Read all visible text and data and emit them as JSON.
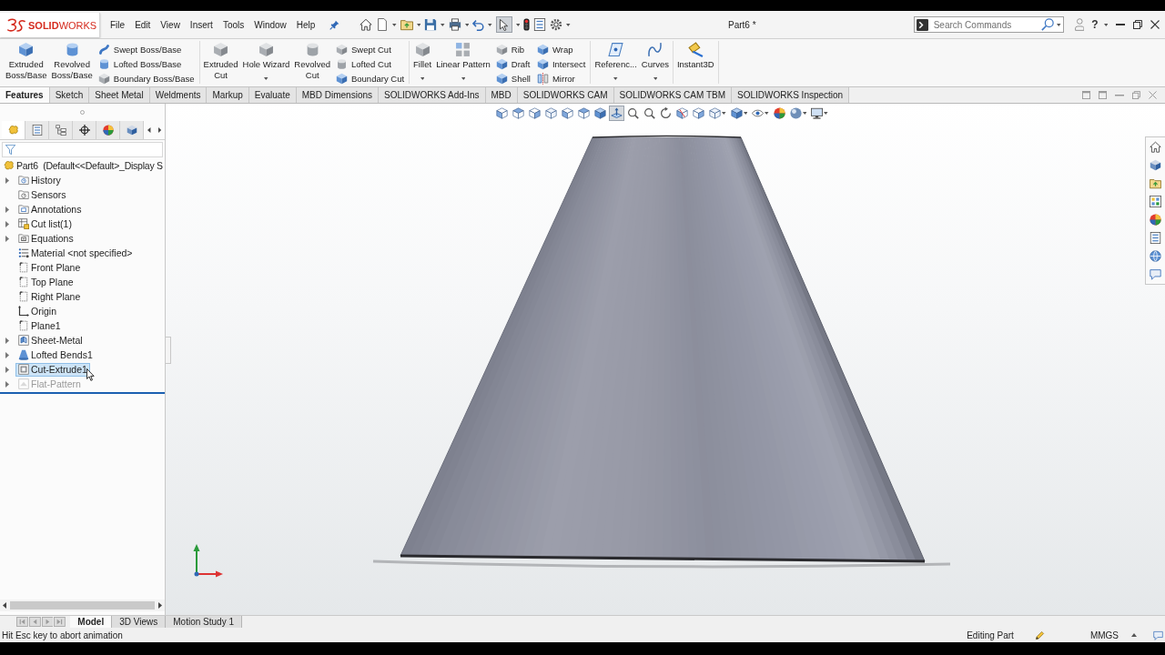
{
  "title_bar": {
    "logo": "**SOLID**WORKS",
    "menu": [
      "File",
      "Edit",
      "View",
      "Insert",
      "Tools",
      "Window",
      "Help"
    ],
    "select_tool_selected": true,
    "document_title": "Part6 *",
    "search": {
      "placeholder": "Search Commands"
    },
    "help": "?"
  },
  "ribbon": {
    "groups": [
      [
        {
          "kind": "large",
          "lines": [
            "Extruded",
            "Boss/Base"
          ],
          "dropdown": false
        },
        {
          "kind": "large",
          "lines": [
            "Revolved",
            "Boss/Base"
          ],
          "dropdown": false
        },
        {
          "kind": "stack",
          "buttons": [
            "Swept Boss/Base",
            "Lofted Boss/Base",
            "Boundary Boss/Base"
          ]
        }
      ],
      [
        {
          "kind": "large",
          "lines": [
            "Extruded",
            "Cut"
          ],
          "dropdown": false
        },
        {
          "kind": "large",
          "lines": [
            "Hole Wizard"
          ],
          "dropdown": true
        },
        {
          "kind": "large",
          "lines": [
            "Revolved",
            "Cut"
          ],
          "dropdown": false
        },
        {
          "kind": "stack",
          "buttons": [
            "Swept Cut",
            "Lofted Cut",
            "Boundary Cut"
          ]
        }
      ],
      [
        {
          "kind": "large",
          "lines": [
            "Fillet"
          ],
          "dropdown": true
        },
        {
          "kind": "large",
          "lines": [
            "Linear Pattern"
          ],
          "dropdown": true
        },
        {
          "kind": "stack",
          "buttons": [
            "Rib",
            "Draft",
            "Shell"
          ]
        },
        {
          "kind": "stack",
          "buttons": [
            "Wrap",
            "Intersect",
            "Mirror"
          ]
        }
      ],
      [
        {
          "kind": "large",
          "lines": [
            "Referenc..."
          ],
          "dropdown": true
        },
        {
          "kind": "large",
          "lines": [
            "Curves"
          ],
          "dropdown": true
        }
      ],
      [
        {
          "kind": "large",
          "lines": [
            "Instant3D"
          ],
          "dropdown": false
        }
      ]
    ]
  },
  "command_tabs": [
    {
      "label": "Features",
      "selected": true
    },
    {
      "label": "Sketch",
      "selected": false
    },
    {
      "label": "Sheet Metal",
      "selected": false
    },
    {
      "label": "Weldments",
      "selected": false
    },
    {
      "label": "Markup",
      "selected": false
    },
    {
      "label": "Evaluate",
      "selected": false
    },
    {
      "label": "MBD Dimensions",
      "selected": false
    },
    {
      "label": "SOLIDWORKS Add-Ins",
      "selected": false
    },
    {
      "label": "MBD",
      "selected": false
    },
    {
      "label": "SOLIDWORKS CAM",
      "selected": false
    },
    {
      "label": "SOLIDWORKS CAM TBM",
      "selected": false
    },
    {
      "label": "SOLIDWORKS Inspection",
      "selected": false
    }
  ],
  "feature_manager": {
    "tabs": [
      {
        "selected": true
      },
      {
        "selected": false
      },
      {
        "selected": false
      },
      {
        "selected": false
      },
      {
        "selected": false
      },
      {
        "selected": false
      }
    ],
    "tree": {
      "label": "Part6  (Default<<Default>_Display S",
      "children": [
        {
          "label": "History",
          "kind": "history",
          "expandable": true,
          "selected": false,
          "suppressed": false
        },
        {
          "label": "Sensors",
          "kind": "sensors",
          "expandable": false,
          "selected": false,
          "suppressed": false
        },
        {
          "label": "Annotations",
          "kind": "annotations",
          "expandable": true,
          "selected": false,
          "suppressed": false
        },
        {
          "label": "Cut list(1)",
          "kind": "cutlist",
          "expandable": true,
          "selected": false,
          "suppressed": false
        },
        {
          "label": "Equations",
          "kind": "equations",
          "expandable": true,
          "selected": false,
          "suppressed": false
        },
        {
          "label": "Material <not specified>",
          "kind": "material",
          "expandable": false,
          "selected": false,
          "suppressed": false
        },
        {
          "label": "Front Plane",
          "kind": "plane",
          "expandable": false,
          "selected": false,
          "suppressed": false
        },
        {
          "label": "Top Plane",
          "kind": "plane",
          "expandable": false,
          "selected": false,
          "suppressed": false
        },
        {
          "label": "Right Plane",
          "kind": "plane",
          "expandable": false,
          "selected": false,
          "suppressed": false
        },
        {
          "label": "Origin",
          "kind": "origin",
          "expandable": false,
          "selected": false,
          "suppressed": false
        },
        {
          "label": "Plane1",
          "kind": "plane",
          "expandable": false,
          "selected": false,
          "suppressed": false
        },
        {
          "label": "Sheet-Metal",
          "kind": "sheetmetal",
          "expandable": true,
          "selected": false,
          "suppressed": false
        },
        {
          "label": "Lofted Bends1",
          "kind": "loft",
          "expandable": true,
          "selected": false,
          "suppressed": false
        },
        {
          "label": "Cut-Extrude1",
          "kind": "cut",
          "expandable": true,
          "selected": true,
          "suppressed": false
        },
        {
          "label": "Flat-Pattern",
          "kind": "flatpattern",
          "expandable": true,
          "selected": false,
          "suppressed": true
        }
      ]
    }
  },
  "graphics_area": {
    "view_toolbar": [
      {
        "selected": false,
        "dropdown": false
      },
      {
        "selected": false,
        "dropdown": false
      },
      {
        "selected": false,
        "dropdown": false
      },
      {
        "selected": false,
        "dropdown": false
      },
      {
        "selected": false,
        "dropdown": false
      },
      {
        "selected": false,
        "dropdown": false
      },
      {
        "selected": false,
        "dropdown": false
      },
      {
        "selected": true,
        "dropdown": false
      },
      {
        "selected": false,
        "dropdown": false
      },
      {
        "selected": false,
        "dropdown": false
      },
      {
        "selected": false,
        "dropdown": false
      },
      {
        "selected": false,
        "dropdown": false
      },
      {
        "selected": false,
        "dropdown": false
      },
      {
        "selected": false,
        "dropdown": true
      },
      {
        "selected": false,
        "dropdown": true
      },
      {
        "selected": false,
        "dropdown": true
      },
      {
        "selected": false,
        "dropdown": false
      },
      {
        "selected": false,
        "dropdown": true
      },
      {
        "selected": false,
        "dropdown": true
      }
    ]
  },
  "bottom_tabs": [
    {
      "label": "Model",
      "selected": true
    },
    {
      "label": "3D Views",
      "selected": false
    },
    {
      "label": "Motion Study 1",
      "selected": false
    }
  ],
  "status_bar": {
    "message": "Hit Esc key to abort animation",
    "mode": "Editing Part",
    "units": "MMGS"
  }
}
